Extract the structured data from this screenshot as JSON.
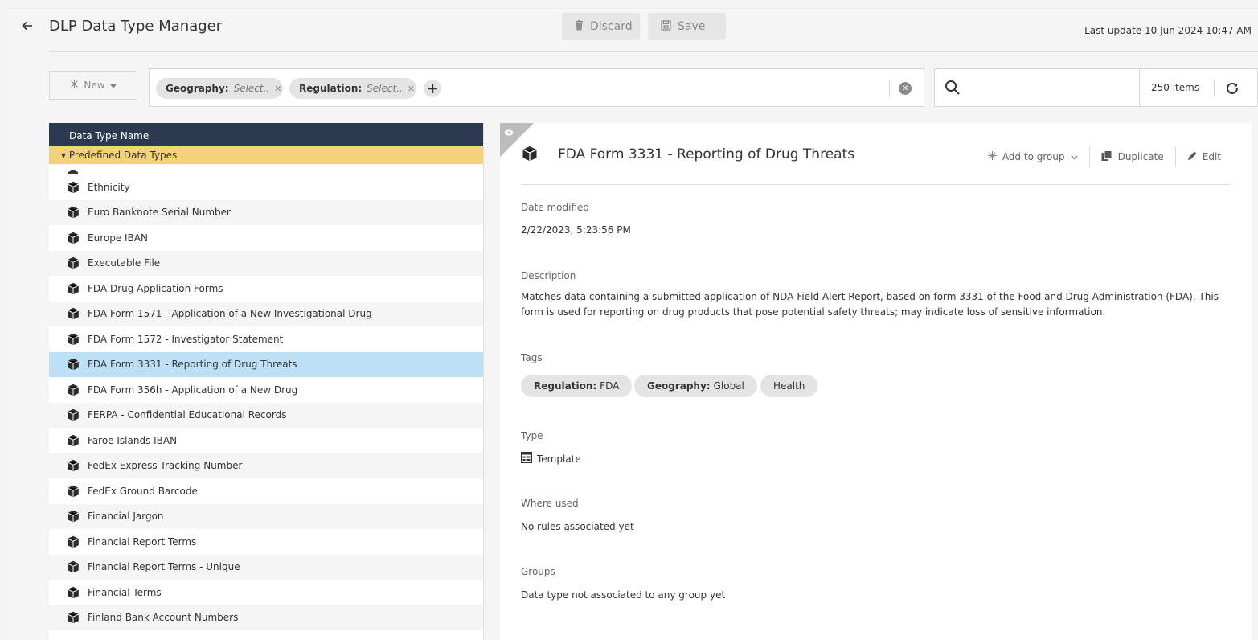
{
  "header": {
    "title": "DLP Data Type Manager",
    "discard_label": "Discard",
    "save_label": "Save",
    "last_update": "Last update 10 Jun 2024 10:47 AM"
  },
  "toolbar": {
    "new_label": "New",
    "filters": [
      {
        "key": "Geography:",
        "value": "Select.."
      },
      {
        "key": "Regulation:",
        "value": "Select.."
      }
    ],
    "search_placeholder": "",
    "items_count": "250 items"
  },
  "list": {
    "column_header": "Data Type Name",
    "group_label": "Predefined Data Types",
    "rows": [
      "Ethnicity",
      "Euro Banknote Serial Number",
      "Europe IBAN",
      "Executable File",
      "FDA Drug Application Forms",
      "FDA Form 1571 - Application of a New Investigational Drug",
      "FDA Form 1572 - Investigator Statement",
      "FDA Form 3331 - Reporting of Drug Threats",
      "FDA Form 356h - Application of a New Drug",
      "FERPA - Confidential Educational Records",
      "Faroe Islands IBAN",
      "FedEx Express Tracking Number",
      "FedEx Ground Barcode",
      "Financial Jargon",
      "Financial Report Terms",
      "Financial Report Terms - Unique",
      "Financial Terms",
      "Finland Bank Account Numbers"
    ],
    "selected_index": 7
  },
  "detail": {
    "title": "FDA Form 3331 - Reporting of Drug Threats",
    "actions": {
      "add_to_group": "Add to group",
      "duplicate": "Duplicate",
      "edit": "Edit"
    },
    "date_modified_label": "Date modified",
    "date_modified": "2/22/2023, 5:23:56 PM",
    "description_label": "Description",
    "description": "Matches data containing a submitted application of NDA-Field Alert Report, based on form 3331 of the Food and Drug Administration (FDA). This form is used for reporting on drug products that pose potential safety threats; may indicate loss of sensitive information.",
    "tags_label": "Tags",
    "tags": [
      {
        "key": "Regulation:",
        "value": "FDA"
      },
      {
        "key": "Geography:",
        "value": "Global"
      },
      {
        "key": "",
        "value": "Health"
      }
    ],
    "type_label": "Type",
    "type_value": "Template",
    "where_used_label": "Where used",
    "where_used": "No rules associated yet",
    "groups_label": "Groups",
    "groups": "Data type not associated to any group yet"
  },
  "colors": {
    "list_header_bg": "#2b3a4e",
    "group_header_bg": "#f4d27a",
    "selected_row_bg": "#bde0f7"
  }
}
